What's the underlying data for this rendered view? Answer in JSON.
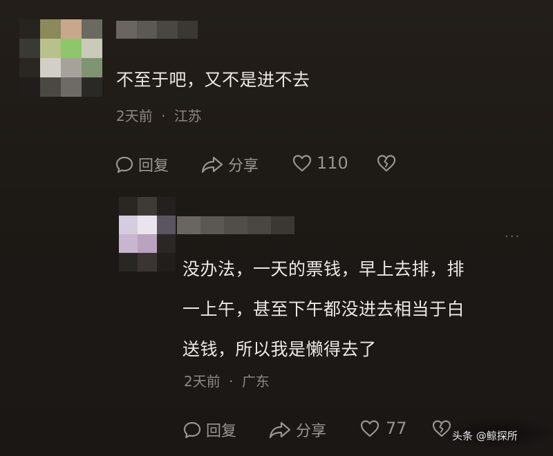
{
  "comments": [
    {
      "text": "不至于吧，又不是进不去",
      "time": "2天前",
      "separator": "·",
      "location": "江苏",
      "reply_label": "回复",
      "share_label": "分享",
      "like_count": "110"
    },
    {
      "text_lines": [
        "没办法，一天的票钱，早上去排，排",
        "一上午，甚至下午都没进去相当于白",
        "送钱，所以我是懒得去了"
      ],
      "time": "2天前",
      "separator": "·",
      "location": "广东",
      "reply_label": "回复",
      "share_label": "分享",
      "like_count": "77",
      "more": "···"
    }
  ],
  "watermark": "头条 @鲸探所",
  "colors": {
    "background": "#1d1915",
    "text": "#ece8e3",
    "muted": "#8e8882"
  },
  "icons": [
    "comment-bubble-icon",
    "share-arrow-icon",
    "heart-icon",
    "broken-heart-icon"
  ]
}
